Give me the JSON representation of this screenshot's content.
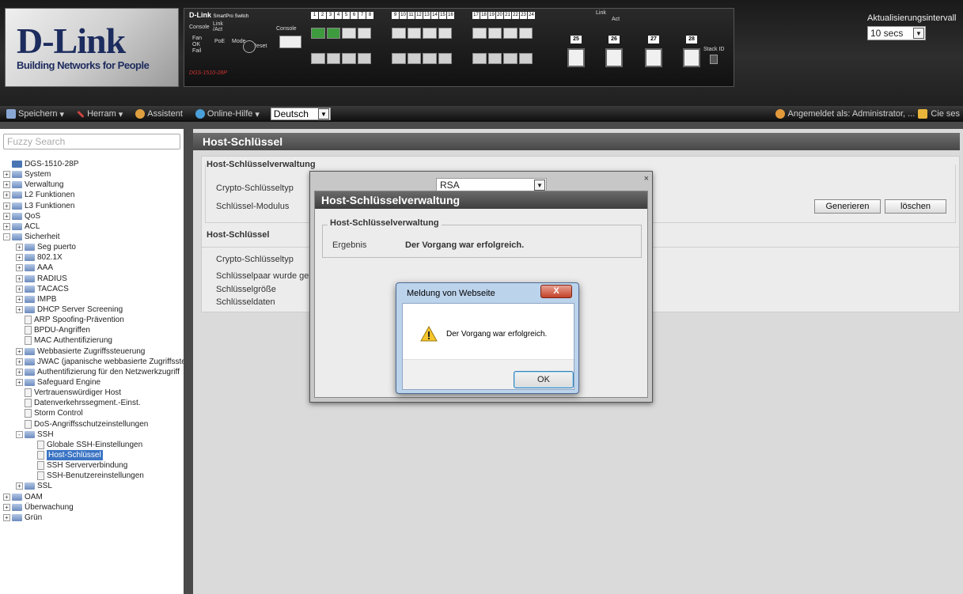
{
  "header": {
    "logo": "D-Link",
    "tagline": "Building Networks for People",
    "device_brand": "D-Link",
    "device_series": "SmartPro Switch",
    "device_model": "DGS-1510-28P",
    "labels": {
      "console": "Console",
      "link_act": "Link /Act",
      "fan": "Fan",
      "ok": "OK",
      "fail": "Fail",
      "poe": "PoE",
      "mode": "Mode",
      "reset": "Reset",
      "console_port": "Console",
      "stack_id": "Stack ID",
      "link": "Link",
      "act": "Act"
    },
    "sfp_ports": [
      "25",
      "26",
      "27",
      "28"
    ],
    "refresh_label": "Aktualisierungsintervall",
    "refresh_value": "10 secs"
  },
  "toolbar": {
    "save": "Speichern",
    "tools": "Herram",
    "wizard": "Assistent",
    "help": "Online-Hilfe",
    "language": "Deutsch",
    "login_text": "Angemeldet als: Administrator, ...",
    "logout": "Cie ses"
  },
  "sidebar": {
    "search_placeholder": "Fuzzy Search",
    "tree": [
      {
        "label": "DGS-1510-28P",
        "level": 0,
        "type": "root",
        "exp": ""
      },
      {
        "label": "System",
        "level": 0,
        "type": "folder",
        "exp": "+"
      },
      {
        "label": "Verwaltung",
        "level": 0,
        "type": "folder",
        "exp": "+"
      },
      {
        "label": "L2 Funktionen",
        "level": 0,
        "type": "folder",
        "exp": "+"
      },
      {
        "label": "L3 Funktionen",
        "level": 0,
        "type": "folder",
        "exp": "+"
      },
      {
        "label": "QoS",
        "level": 0,
        "type": "folder",
        "exp": "+"
      },
      {
        "label": "ACL",
        "level": 0,
        "type": "folder",
        "exp": "+"
      },
      {
        "label": "Sicherheit",
        "level": 0,
        "type": "folder",
        "exp": "-"
      },
      {
        "label": "Seg puerto",
        "level": 1,
        "type": "folder",
        "exp": "+"
      },
      {
        "label": "802.1X",
        "level": 1,
        "type": "folder",
        "exp": "+"
      },
      {
        "label": "AAA",
        "level": 1,
        "type": "folder",
        "exp": "+"
      },
      {
        "label": "RADIUS",
        "level": 1,
        "type": "folder",
        "exp": "+"
      },
      {
        "label": "TACACS",
        "level": 1,
        "type": "folder",
        "exp": "+"
      },
      {
        "label": "IMPB",
        "level": 1,
        "type": "folder",
        "exp": "+"
      },
      {
        "label": "DHCP Server Screening",
        "level": 1,
        "type": "folder",
        "exp": "+"
      },
      {
        "label": "ARP Spoofing-Prävention",
        "level": 1,
        "type": "doc",
        "exp": ""
      },
      {
        "label": "BPDU-Angriffen",
        "level": 1,
        "type": "doc",
        "exp": ""
      },
      {
        "label": "MAC Authentifizierung",
        "level": 1,
        "type": "doc",
        "exp": ""
      },
      {
        "label": "Webbasierte Zugriffssteuerung",
        "level": 1,
        "type": "folder",
        "exp": "+"
      },
      {
        "label": "JWAC (japanische webbasierte Zugriffssteue",
        "level": 1,
        "type": "folder",
        "exp": "+"
      },
      {
        "label": "Authentifizierung für den Netzwerkzugriff",
        "level": 1,
        "type": "folder",
        "exp": "+"
      },
      {
        "label": "Safeguard Engine",
        "level": 1,
        "type": "folder",
        "exp": "+"
      },
      {
        "label": "Vertrauenswürdiger Host",
        "level": 1,
        "type": "doc",
        "exp": ""
      },
      {
        "label": "Datenverkehrssegment.-Einst.",
        "level": 1,
        "type": "doc",
        "exp": ""
      },
      {
        "label": "Storm Control",
        "level": 1,
        "type": "doc",
        "exp": ""
      },
      {
        "label": "DoS-Angriffsschutzeinstellungen",
        "level": 1,
        "type": "doc",
        "exp": ""
      },
      {
        "label": "SSH",
        "level": 1,
        "type": "folder",
        "exp": "-"
      },
      {
        "label": "Globale SSH-Einstellungen",
        "level": 2,
        "type": "doc",
        "exp": ""
      },
      {
        "label": "Host-Schlüssel",
        "level": 2,
        "type": "doc",
        "exp": "",
        "selected": true
      },
      {
        "label": "SSH Serververbindung",
        "level": 2,
        "type": "doc",
        "exp": ""
      },
      {
        "label": "SSH-Benutzereinstellungen",
        "level": 2,
        "type": "doc",
        "exp": ""
      },
      {
        "label": "SSL",
        "level": 1,
        "type": "folder",
        "exp": "+"
      },
      {
        "label": "OAM",
        "level": 0,
        "type": "folder",
        "exp": "+"
      },
      {
        "label": "Überwachung",
        "level": 0,
        "type": "folder",
        "exp": "+"
      },
      {
        "label": "Grün",
        "level": 0,
        "type": "folder",
        "exp": "+"
      }
    ]
  },
  "main": {
    "title": "Host-Schlüssel",
    "section1_legend": "Host-Schlüsselverwaltung",
    "crypto_label": "Crypto-Schlüsseltyp",
    "crypto_value": "RSA",
    "modulus_label": "Schlüssel-Modulus",
    "generate_button": "Generieren",
    "delete_button": "löschen",
    "section2_title": "Host-Schlüssel",
    "crypto_label2": "Crypto-Schlüsseltyp",
    "keypair_label": "Schlüsselpaar wurde gener",
    "keysize_label": "Schlüsselgröße",
    "keydata_label": "Schlüsseldaten"
  },
  "modal": {
    "close": "×",
    "title": "Host-Schlüsselverwaltung",
    "legend": "Host-Schlüsselverwaltung",
    "result_label": "Ergebnis",
    "result_value": "Der Vorgang war erfolgreich."
  },
  "alert": {
    "title": "Meldung von Webseite",
    "close": "X",
    "message": "Der Vorgang war erfolgreich.",
    "ok": "OK"
  }
}
